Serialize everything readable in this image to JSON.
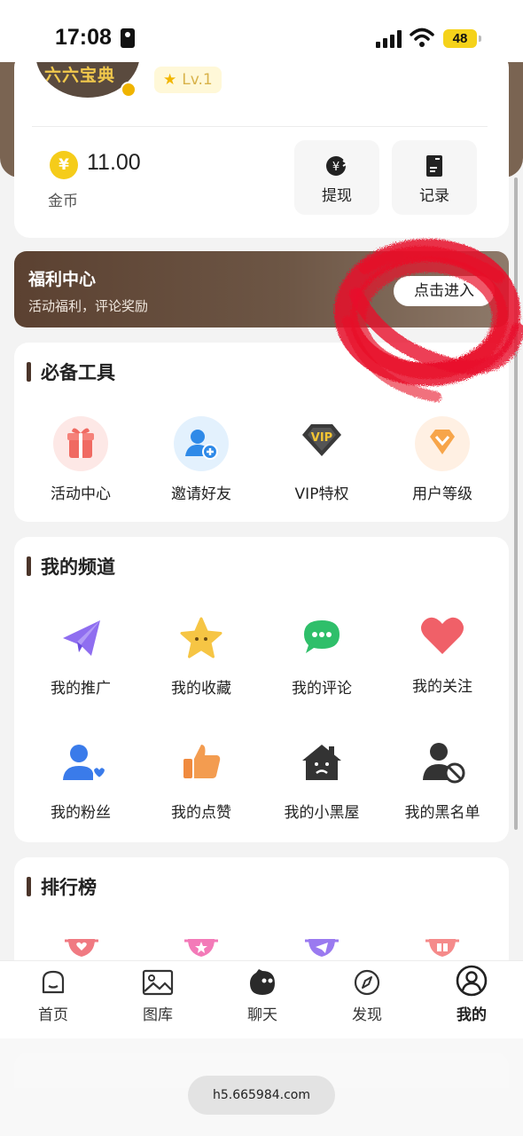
{
  "status_bar": {
    "time": "17:08",
    "battery": "48"
  },
  "profile": {
    "avatar_text": "六六宝典",
    "level": "Lv.1",
    "coin_symbol": "¥",
    "coin_amount": "11.00",
    "coin_label": "金币",
    "actions": [
      {
        "label": "提现",
        "icon": "withdraw-icon"
      },
      {
        "label": "记录",
        "icon": "record-icon"
      }
    ]
  },
  "welfare": {
    "title": "福利中心",
    "subtitle": "活动福利，评论奖励",
    "button": "点击进入"
  },
  "tools": {
    "title": "必备工具",
    "items": [
      {
        "label": "活动中心",
        "icon": "gift-icon"
      },
      {
        "label": "邀请好友",
        "icon": "add-user-icon"
      },
      {
        "label": "VIP特权",
        "icon": "vip-icon"
      },
      {
        "label": "用户等级",
        "icon": "diamond-icon"
      }
    ]
  },
  "channels": {
    "title": "我的频道",
    "items": [
      {
        "label": "我的推广",
        "icon": "paper-plane-icon"
      },
      {
        "label": "我的收藏",
        "icon": "star-icon"
      },
      {
        "label": "我的评论",
        "icon": "chat-icon"
      },
      {
        "label": "我的关注",
        "icon": "heart-icon"
      },
      {
        "label": "我的粉丝",
        "icon": "fan-user-icon"
      },
      {
        "label": "我的点赞",
        "icon": "thumbs-up-icon"
      },
      {
        "label": "我的小黑屋",
        "icon": "dark-house-icon"
      },
      {
        "label": "我的黑名单",
        "icon": "blocked-user-icon"
      }
    ]
  },
  "ranking": {
    "title": "排行榜"
  },
  "tabbar": {
    "items": [
      {
        "label": "首页",
        "icon": "home-icon"
      },
      {
        "label": "图库",
        "icon": "gallery-icon"
      },
      {
        "label": "聊天",
        "icon": "chat-bubble-icon"
      },
      {
        "label": "发现",
        "icon": "compass-icon"
      },
      {
        "label": "我的",
        "icon": "user-icon"
      }
    ],
    "active": "我的"
  },
  "browser": {
    "url": "h5.665984.com"
  },
  "colors": {
    "brand_brown": "#5b4131",
    "coin_yellow": "#f5cc1a",
    "annotation_red": "#e8102a"
  }
}
